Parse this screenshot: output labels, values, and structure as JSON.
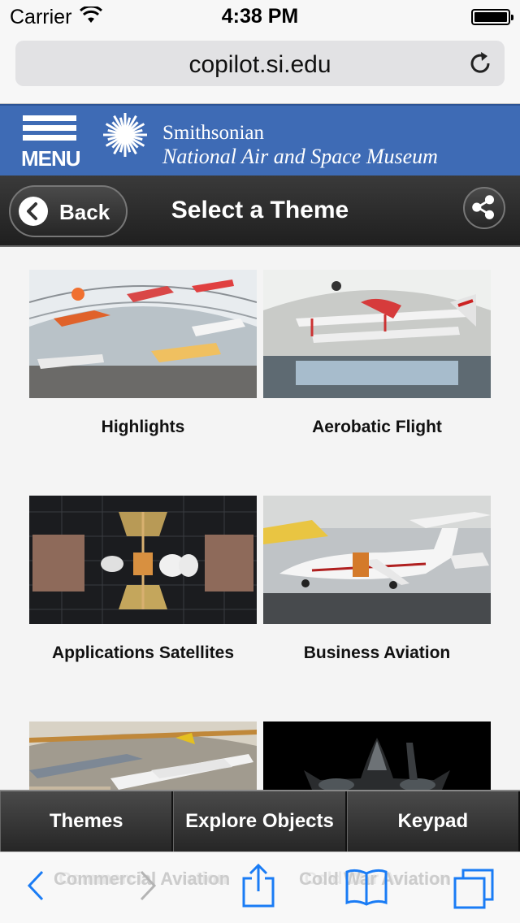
{
  "status_bar": {
    "carrier": "Carrier",
    "time": "4:38 PM",
    "battery_level": 1.0
  },
  "browser": {
    "url": "copilot.si.edu"
  },
  "site_header": {
    "menu_label": "MENU",
    "brand_line1": "Smithsonian",
    "brand_line2": "National Air and Space Museum",
    "color": "#3e6bb5"
  },
  "nav": {
    "back_label": "Back",
    "title": "Select a Theme"
  },
  "themes": [
    {
      "label": "Highlights",
      "image": "hangar-aircraft-photo"
    },
    {
      "label": "Aerobatic Flight",
      "image": "aerobatic-biplane-photo"
    },
    {
      "label": "Applications Satellites",
      "image": "satellite-display-photo"
    },
    {
      "label": "Business Aviation",
      "image": "business-jet-photo"
    },
    {
      "label": "Commercial Aviation",
      "image": "concorde-hangar-photo"
    },
    {
      "label": "Cold War Aviation",
      "image": "blackbird-photo"
    }
  ],
  "tabs": {
    "themes": "Themes",
    "explore": "Explore Objects",
    "keypad": "Keypad"
  }
}
